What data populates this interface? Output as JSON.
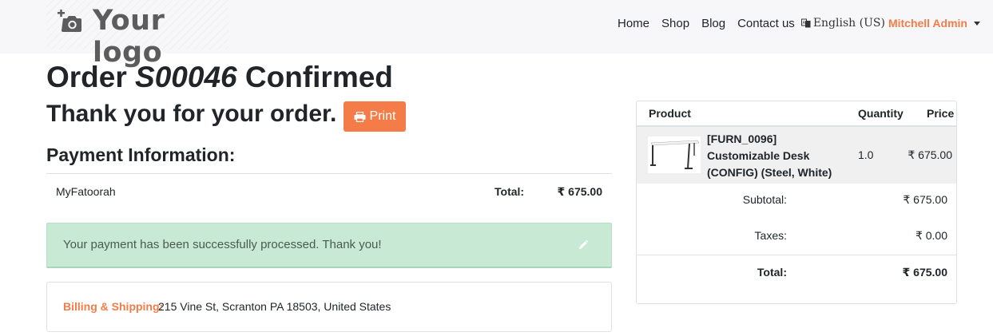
{
  "header": {
    "logo_text": "Your logo",
    "nav": [
      {
        "label": "Home"
      },
      {
        "label": "Shop"
      },
      {
        "label": "Blog"
      },
      {
        "label": "Contact us"
      }
    ],
    "language": "English (US)",
    "user": "Mitchell Admin"
  },
  "order": {
    "prefix": "Order ",
    "number": "S00046",
    "suffix": " Confirmed",
    "thanks": "Thank you for your order.",
    "print_label": "Print"
  },
  "payment": {
    "heading": "Payment Information:",
    "method": "MyFatoorah",
    "total_label": "Total:",
    "total_value": "₹ 675.00",
    "alert": "Your payment has been successfully processed. Thank you!"
  },
  "address": {
    "label": "Billing & Shipping:",
    "value": "215 Vine St, Scranton PA 18503, United States"
  },
  "summary": {
    "headers": {
      "product": "Product",
      "quantity": "Quantity",
      "price": "Price"
    },
    "line": {
      "name": "[FURN_0096] Customizable Desk (CONFIG) (Steel, White)",
      "quantity": "1.0",
      "price": "₹ 675.00"
    },
    "subtotal_label": "Subtotal:",
    "subtotal_value": "₹ 675.00",
    "taxes_label": "Taxes:",
    "taxes_value": "₹ 0.00",
    "total_label": "Total:",
    "total_value": "₹ 675.00"
  },
  "colors": {
    "accent": "#f47c48",
    "alert_bg": "#c8ead4",
    "header_bg": "#f7f7f9"
  },
  "icons": [
    "camera-icon",
    "language-icon",
    "caret-down-icon",
    "print-icon",
    "pencil-icon"
  ]
}
